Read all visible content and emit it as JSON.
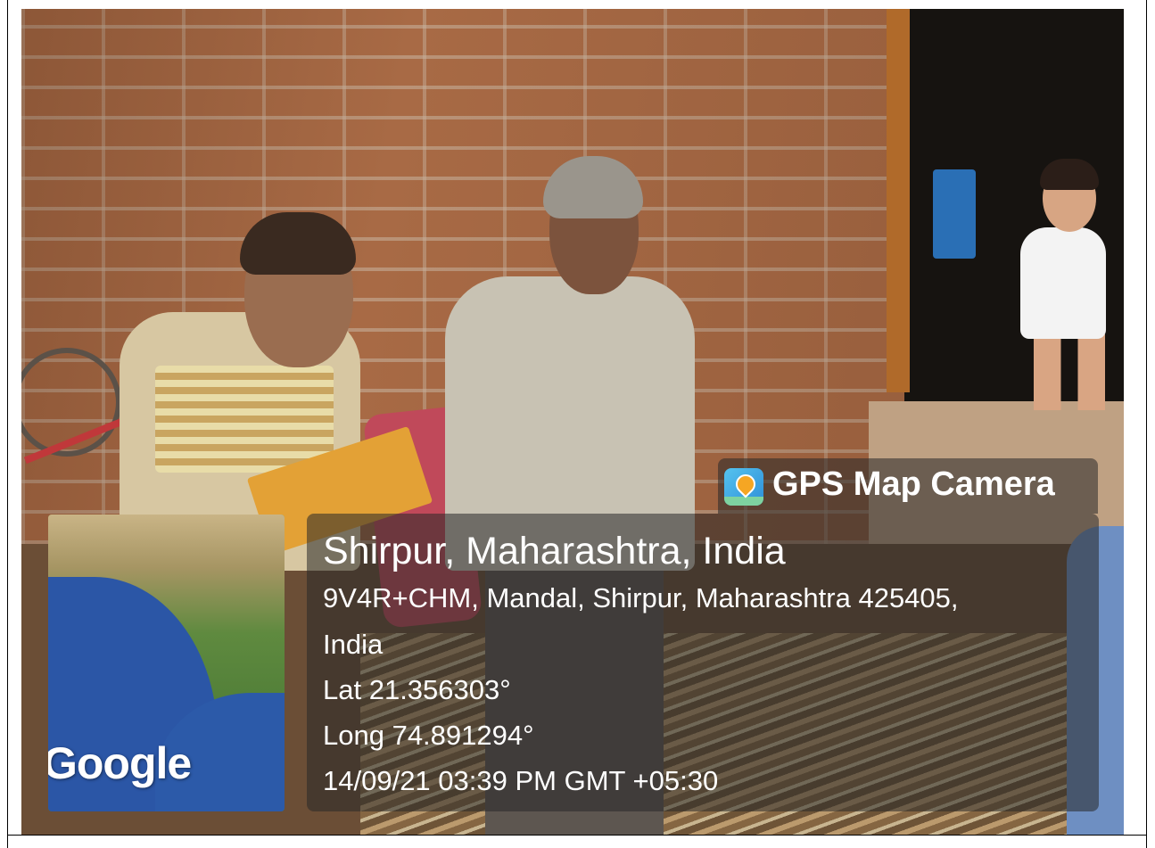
{
  "badge": {
    "text": "GPS Map Camera",
    "icon": "gps-map-camera-app-icon"
  },
  "map": {
    "logo_text": "Google"
  },
  "location": {
    "title": "Shirpur, Maharashtra, India",
    "address_line1": "9V4R+CHM, Mandal, Shirpur, Maharashtra 425405,",
    "address_line2": "India",
    "lat": "Lat 21.356303°",
    "long": "Long 74.891294°",
    "datetime": "14/09/21 03:39 PM GMT +05:30"
  },
  "colors": {
    "overlay": "#282828",
    "text": "#ffffff",
    "sea": "#2b56a6",
    "land": "#5f8a3f"
  }
}
